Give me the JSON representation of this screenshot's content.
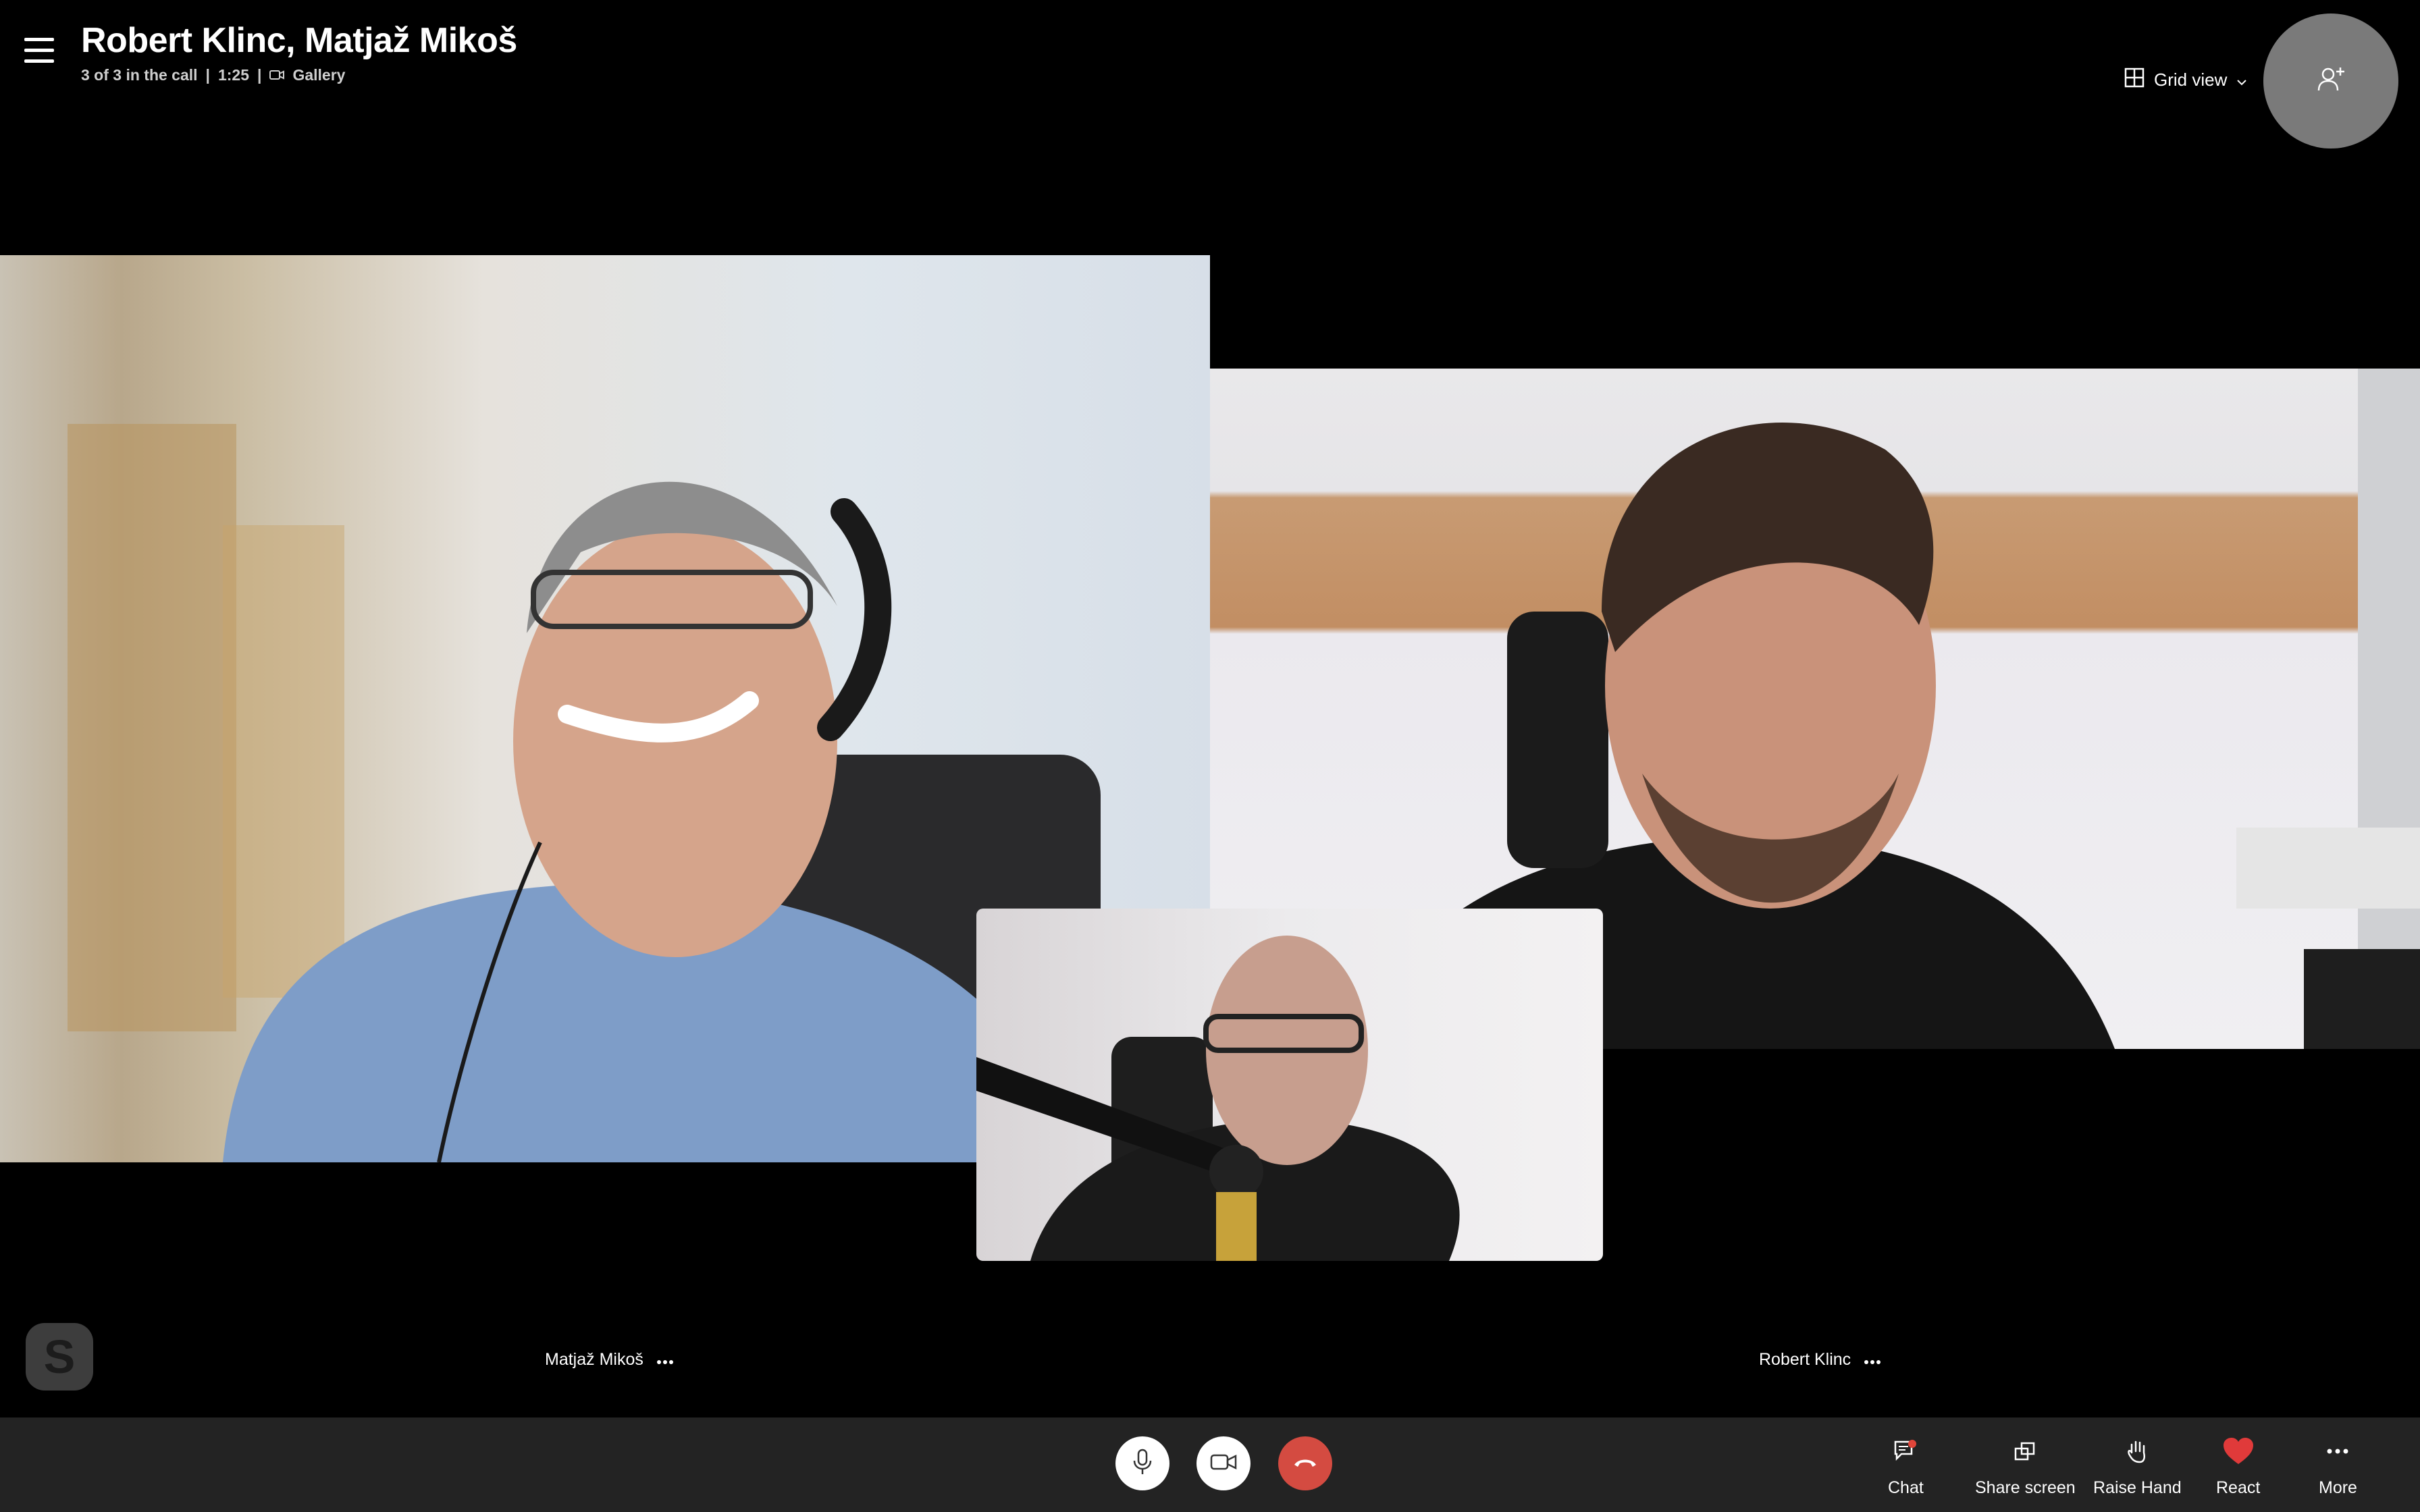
{
  "header": {
    "title": "Robert Klinc, Matjaž Mikoš",
    "participants": "3 of 3 in the call",
    "duration": "1:25",
    "layout_label": "Gallery"
  },
  "view": {
    "label": "Grid view"
  },
  "participants": [
    {
      "name": "Matjaž Mikoš"
    },
    {
      "name": "Robert Klinc"
    }
  ],
  "toolbar": {
    "chat": "Chat",
    "share": "Share screen",
    "raise": "Raise Hand",
    "react": "React",
    "more": "More"
  },
  "colors": {
    "end_call": "#d44b41",
    "react_heart": "#e03a3a",
    "chat_badge": "#e0453a",
    "background": "#000000",
    "toolbar": "#232323"
  },
  "icons": [
    "menu-icon",
    "camera-icon",
    "grid-icon",
    "chevron-down-icon",
    "add-person-icon",
    "more-icon",
    "skype-logo",
    "microphone-icon",
    "video-icon",
    "end-call-icon",
    "chat-icon",
    "share-screen-icon",
    "raise-hand-icon",
    "heart-icon"
  ]
}
